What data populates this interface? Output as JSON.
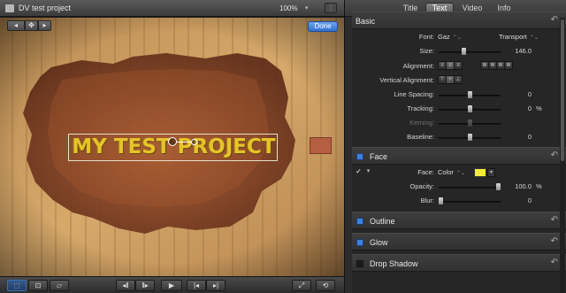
{
  "viewer": {
    "project_title": "DV test project",
    "zoom": "100%",
    "zoom_caret": "▾",
    "view_menu_icon": "switch-icon",
    "done_label": "Done",
    "title_text": "MY TEST PROJECT",
    "tools": {
      "nav_back": "◂",
      "nav_icon": "✥",
      "nav_forward": "▸"
    },
    "transport": {
      "prev_frame": "◂‖",
      "next_frame": "‖▸",
      "play": "▶",
      "go_start": "|◂",
      "go_end": "▸|",
      "fullscreen": "⤢",
      "loop": "⟲"
    },
    "colors": {
      "title_fill": "#e7c32a",
      "title_stroke": "#6a4a10",
      "wood": "#c9955a",
      "stain": "#7a3b22",
      "color_well": "#b55f42",
      "done_button": "#3d7ddb"
    }
  },
  "inspector": {
    "tabs": [
      {
        "label": "Title"
      },
      {
        "label": "Text"
      },
      {
        "label": "Video"
      },
      {
        "label": "Info"
      }
    ],
    "basic": {
      "header": "Basic",
      "font_label": "Font:",
      "font_value": "Gaz",
      "font_style": "Transport",
      "size_label": "Size:",
      "size_value": "146.0",
      "size_level": 0.4,
      "alignment_label": "Alignment:",
      "vertical_alignment_label": "Vertical Alignment:",
      "line_spacing_label": "Line Spacing:",
      "line_spacing_value": "0",
      "line_spacing_level": 0.5,
      "tracking_label": "Tracking:",
      "tracking_value": "0",
      "tracking_unit": "%",
      "tracking_level": 0.5,
      "kerning_label": "Kerning:",
      "kerning_level": 0.5,
      "baseline_label": "Baseline:",
      "baseline_value": "0",
      "baseline_level": 0.5
    },
    "face": {
      "header": "Face",
      "enabled": true,
      "check_glyph": "✓",
      "disclosure_glyph": "▾",
      "face_label": "Face:",
      "face_fill_type": "Color",
      "face_color": "#f4ee30",
      "opacity_label": "Opacity:",
      "opacity_value": "100.0",
      "opacity_unit": "%",
      "opacity_level": 1.0,
      "blur_label": "Blur:",
      "blur_value": "0",
      "blur_level": 0.0
    },
    "outline": {
      "header": "Outline",
      "enabled": true
    },
    "glow": {
      "header": "Glow",
      "enabled": true
    },
    "drop_shadow": {
      "header": "Drop Shadow",
      "enabled": false
    },
    "reset_icon": "↶",
    "popup_arrows": "⌃⌄"
  }
}
